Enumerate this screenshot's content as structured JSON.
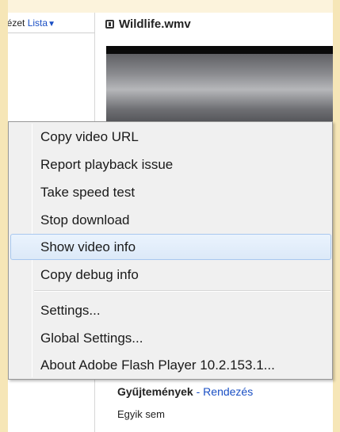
{
  "left_panel": {
    "view_label": "lézet",
    "view_link": "Lista",
    "view_arrow": "▼"
  },
  "video": {
    "title": "Wildlife.wmv",
    "icon": "film-icon"
  },
  "collections": {
    "heading": "Gyűjtemények",
    "separator": " - ",
    "sort_link": "Rendezés",
    "none_text": "Egyik sem"
  },
  "context_menu": {
    "items": [
      {
        "label": "Copy video URL"
      },
      {
        "label": "Report playback issue"
      },
      {
        "label": "Take speed test"
      },
      {
        "label": "Stop download"
      },
      {
        "label": "Show video info",
        "highlighted": true
      },
      {
        "label": "Copy debug info"
      },
      {
        "label": "Settings..."
      },
      {
        "label": "Global Settings..."
      },
      {
        "label": "About Adobe Flash Player 10.2.153.1..."
      }
    ]
  },
  "colors": {
    "frame": "#f6e6b7",
    "link": "#1a4fc4",
    "menu_bg": "#f0f0f0",
    "highlight": "#dce9f8"
  }
}
